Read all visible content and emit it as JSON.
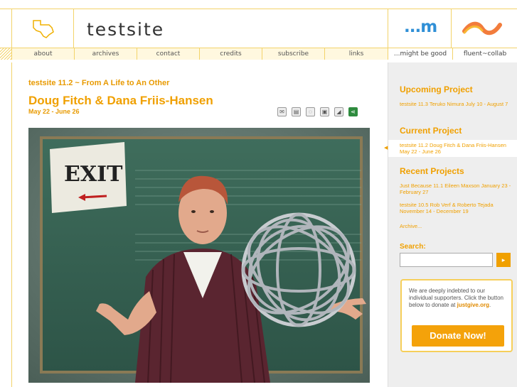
{
  "header": {
    "site_title": "testsite",
    "m_logo": "...m"
  },
  "nav": {
    "items": [
      "about",
      "archives",
      "contact",
      "credits",
      "subscribe",
      "links"
    ],
    "right_items": [
      "...might be good",
      "fluent~collab"
    ]
  },
  "main": {
    "subtitle": "testsite 11.2 ~ From A Life to An Other",
    "title": "Doug Fitch & Dana Friis-Hansen",
    "dates": "May 22 - June 26",
    "share_icons": [
      "email-icon",
      "print-icon",
      "comment-icon",
      "bookmark-icon",
      "rss-icon",
      "share-icon"
    ],
    "photo_sign": "EXIT"
  },
  "sidebar": {
    "upcoming_heading": "Upcoming Project",
    "upcoming_link": "testsite 11.3 Teruko Nimura July 10 - August 7",
    "current_heading": "Current Project",
    "current_link": "testsite 11.2 Doug Fitch & Dana Friis-Hansen May 22 - June 26",
    "recent_heading": "Recent Projects",
    "recent_links": [
      "Just Because 11.1 Eileen Maxson January 23 - February 27",
      "testsite 10.5 Rob Verf & Roberto Tejada November 14 - December 19"
    ],
    "archive_link": "Archive...",
    "search_label": "Search:",
    "search_value": "",
    "search_button": "▸",
    "support_text": "We are deeply indebted to our individual supporters. Click the button below to donate at",
    "support_link": "justgive.org",
    "support_period": ".",
    "donate_label": "Donate Now!"
  },
  "colors": {
    "accent": "#f0a000",
    "border": "#f3d36a",
    "m_logo": "#2f8fd6"
  }
}
